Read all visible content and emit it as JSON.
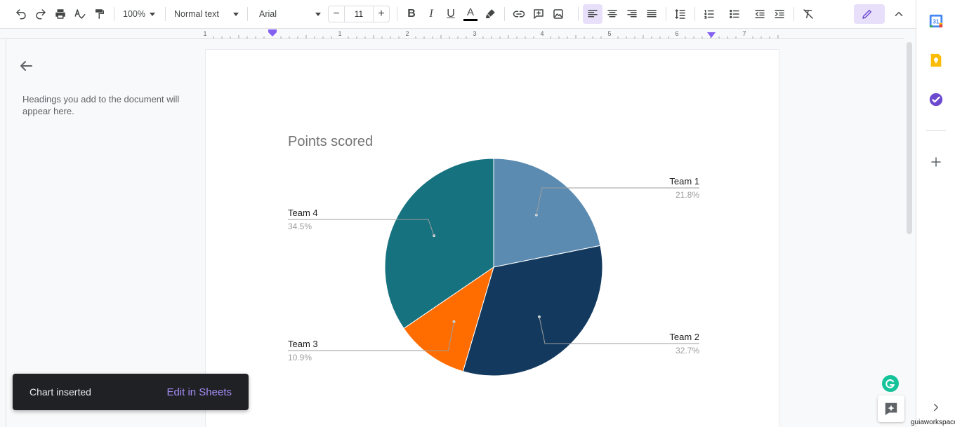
{
  "toolbar": {
    "zoom": "100%",
    "style": "Normal text",
    "font": "Arial",
    "font_size": "11"
  },
  "ruler": {
    "labels": [
      "1",
      "1",
      "2",
      "3",
      "4",
      "5",
      "6",
      "7"
    ]
  },
  "outline": {
    "placeholder": "Headings you add to the document will appear here."
  },
  "chart_data": {
    "type": "pie",
    "title": "Points scored",
    "categories": [
      "Team 1",
      "Team 2",
      "Team 3",
      "Team 4"
    ],
    "values": [
      21.8,
      32.7,
      10.9,
      34.5
    ],
    "labels": [
      "21.8%",
      "32.7%",
      "10.9%",
      "34.5%"
    ],
    "colors": [
      "#5b8bb1",
      "#133a5e",
      "#ff6d00",
      "#17727f"
    ]
  },
  "toast": {
    "message": "Chart inserted",
    "action": "Edit in Sheets"
  },
  "watermark": "guiaworkspace",
  "colors": {
    "accent": "#8561f2",
    "toolbar_active_bg": "#e8e0fb",
    "grammarly": "#15c39a"
  }
}
